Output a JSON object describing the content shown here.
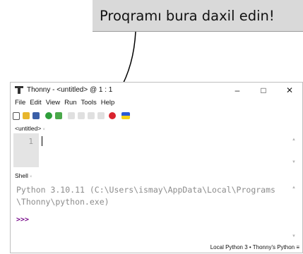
{
  "callout": {
    "text": "Proqramı bura daxil edin!"
  },
  "window": {
    "title": "Thonny  -  <untitled>  @  1 : 1",
    "controls": {
      "minimize": "–",
      "maximize": "□",
      "close": "✕"
    }
  },
  "menu": [
    "File",
    "Edit",
    "View",
    "Run",
    "Tools",
    "Help"
  ],
  "toolbar_icons": [
    "new-file-icon",
    "open-file-icon",
    "save-icon",
    "run-icon",
    "debug-icon",
    "step-over-icon",
    "step-into-icon",
    "step-out-icon",
    "resume-icon",
    "stop-icon",
    "flag-icon"
  ],
  "editor": {
    "tab_label": "<untitled>",
    "tab_close": "×",
    "line_number": "1"
  },
  "shell": {
    "tab_label": "Shell",
    "tab_close": "×",
    "lines": [
      "Python 3.10.11 (C:\\Users\\ismay\\AppData\\Local\\Programs",
      "\\Thonny\\python.exe)"
    ],
    "prompt": ">>>"
  },
  "status": "Local Python 3  •  Thonny's Python  ≡"
}
